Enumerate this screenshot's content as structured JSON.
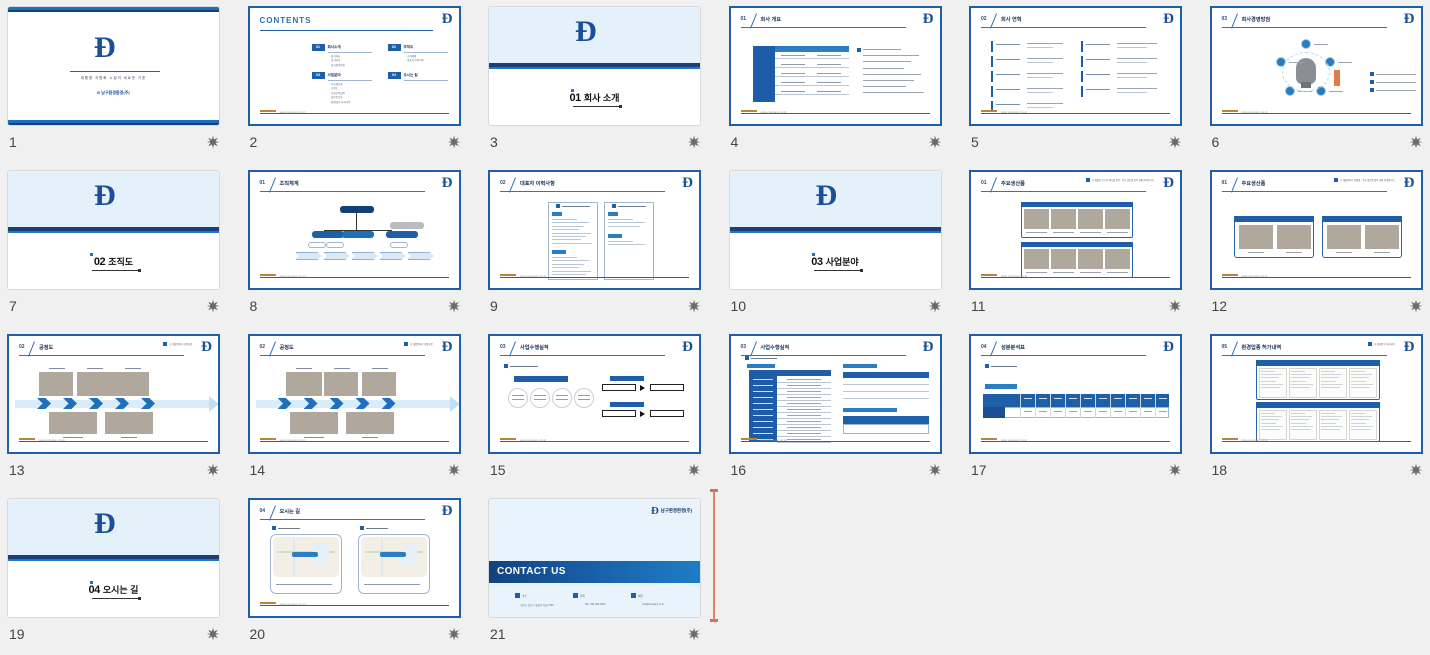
{
  "app": {
    "view": "slide-sorter",
    "background_color": "#f0f0f0",
    "accent_color": "#1f5fa8",
    "selection_border_color": "#1f5fa8",
    "cursor_color": "#e0836b"
  },
  "icons": {
    "star": "star-icon",
    "logo": "company-logo-d-icon"
  },
  "slides": [
    {
      "number": "1",
      "selected": false,
      "layout": "title",
      "title_tagline": "재활용 자원화 시설의 새로운 기준",
      "company": "남구환경환경(주)"
    },
    {
      "number": "2",
      "selected": true,
      "layout": "contents",
      "heading": "CONTENTS",
      "items": [
        {
          "num": "01",
          "label": "회사소개",
          "subs": [
            "회사개요",
            "회사연혁",
            "회사경영방침"
          ]
        },
        {
          "num": "02",
          "label": "조직도",
          "subs": [
            "조직체계",
            "대표자 이력사항"
          ]
        },
        {
          "num": "03",
          "label": "사업분야",
          "subs": [
            "주요생산품",
            "공정도",
            "사업수행실적",
            "성분분석표",
            "환경업종 허가내역"
          ]
        },
        {
          "num": "04",
          "label": "오시는 길",
          "subs": []
        }
      ]
    },
    {
      "number": "3",
      "selected": false,
      "layout": "section",
      "sec_num": "01",
      "sec_title": "회사 소개"
    },
    {
      "number": "4",
      "selected": true,
      "layout": "table-text",
      "head_num": "01",
      "head_title": "회사 개요"
    },
    {
      "number": "5",
      "selected": true,
      "layout": "history",
      "head_num": "02",
      "head_title": "회사 연혁"
    },
    {
      "number": "6",
      "selected": true,
      "layout": "policy",
      "head_num": "03",
      "head_title": "회사경영방침"
    },
    {
      "number": "7",
      "selected": false,
      "layout": "section",
      "sec_num": "02",
      "sec_title": "조직도"
    },
    {
      "number": "8",
      "selected": true,
      "layout": "orgchart",
      "head_num": "01",
      "head_title": "조직체계"
    },
    {
      "number": "9",
      "selected": true,
      "layout": "two-docs",
      "head_num": "02",
      "head_title": "대표자 이력사항"
    },
    {
      "number": "10",
      "selected": false,
      "layout": "section",
      "sec_num": "03",
      "sec_title": "사업분야"
    },
    {
      "number": "11",
      "selected": true,
      "layout": "products-8",
      "head_num": "01",
      "head_title": "주요생산품",
      "note": "※ 재활용 가능한 폐기물 품목 · 주요 생산품 품목 현황 안내입니다"
    },
    {
      "number": "12",
      "selected": true,
      "layout": "products-4",
      "head_num": "01",
      "head_title": "주요생산품",
      "note": "※ 재활용처리 현황별 · 주요 생산품 품목 현황 안내입니다"
    },
    {
      "number": "13",
      "selected": true,
      "layout": "process-a",
      "head_num": "02",
      "head_title": "공정도",
      "note": "※ 재활용처리 공정과정"
    },
    {
      "number": "14",
      "selected": true,
      "layout": "process-b",
      "head_num": "02",
      "head_title": "공정도",
      "note": "※ 재활용처리 공정과정"
    },
    {
      "number": "15",
      "selected": true,
      "layout": "biz-flow",
      "head_num": "03",
      "head_title": "사업수행실적",
      "note": "※ 사업수행실적 개요"
    },
    {
      "number": "16",
      "selected": true,
      "layout": "biz-table",
      "head_num": "03",
      "head_title": "사업수행실적",
      "note": "※ 사업수행실적 현황"
    },
    {
      "number": "17",
      "selected": true,
      "layout": "analysis",
      "head_num": "04",
      "head_title": "성분분석표",
      "note": "※ 성분분석 결과표"
    },
    {
      "number": "18",
      "selected": true,
      "layout": "permits",
      "head_num": "05",
      "head_title": "환경업종 허가내역",
      "note": "※ 환경업종 허가내역",
      "group1": "허가증 및 등록증 사본",
      "group2": "환경업종 허가내역"
    },
    {
      "number": "19",
      "selected": false,
      "layout": "section",
      "sec_num": "04",
      "sec_title": "오시는 길"
    },
    {
      "number": "20",
      "selected": true,
      "layout": "maps",
      "head_num": "04",
      "head_title": "오시는 길",
      "map1_label": "경기도 김포시 대곶면 대곶로 999",
      "map2_label": "서울사업장 서울 특별시 강서구 공항대로",
      "tag1": "※ 본사위치",
      "tag2": "※ 서울사업장 위치"
    },
    {
      "number": "21",
      "selected": false,
      "layout": "contact",
      "title": "CONTACT US",
      "company": "남구환경환경(주)",
      "contacts": [
        {
          "label": "주소",
          "value": "경기도 김포시 대곶면 대곶로 999"
        },
        {
          "label": "전화",
          "value": "TEL. 031-000-0000"
        },
        {
          "label": "메일",
          "value": "info@company.co.kr"
        }
      ]
    }
  ]
}
